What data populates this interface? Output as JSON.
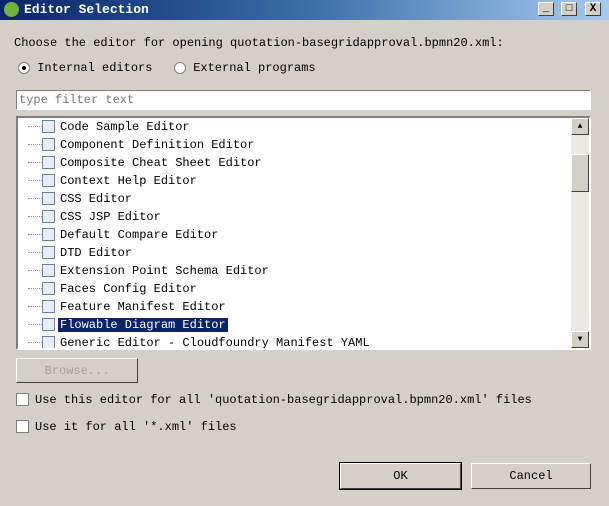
{
  "window": {
    "title": "Editor Selection",
    "minimize": "_",
    "maximize": "□",
    "close": "X"
  },
  "prompt": "Choose the editor for opening quotation-basegridapproval.bpmn20.xml:",
  "radios": {
    "internal": {
      "label": "Internal editors",
      "checked": true
    },
    "external": {
      "label": "External programs",
      "checked": false
    }
  },
  "filter": {
    "value": "",
    "placeholder": "type filter text"
  },
  "editors": [
    {
      "label": "Code Sample Editor",
      "icon": "code-sample-icon"
    },
    {
      "label": "Component Definition Editor",
      "icon": "component-icon"
    },
    {
      "label": "Composite Cheat Sheet Editor",
      "icon": "cheat-sheet-icon"
    },
    {
      "label": "Context Help Editor",
      "icon": "help-book-icon"
    },
    {
      "label": "CSS Editor",
      "icon": "css-file-icon"
    },
    {
      "label": "CSS JSP Editor",
      "icon": "css-file-icon"
    },
    {
      "label": "Default Compare Editor",
      "icon": "compare-icon"
    },
    {
      "label": "DTD Editor",
      "icon": "dtd-file-icon"
    },
    {
      "label": "Extension Point Schema Editor",
      "icon": "plugin-icon"
    },
    {
      "label": "Faces Config Editor",
      "icon": "faces-config-icon"
    },
    {
      "label": "Feature Manifest Editor",
      "icon": "feature-icon"
    },
    {
      "label": "Flowable Diagram Editor",
      "icon": "flowable-icon",
      "selected": true
    },
    {
      "label": "Generic Editor - Cloudfoundry Manifest YAML",
      "icon": "cloud-icon"
    }
  ],
  "browse_label": "Browse...",
  "checkboxes": [
    {
      "label": "Use this editor for all 'quotation-basegridapproval.bpmn20.xml' files",
      "checked": false
    },
    {
      "label": "Use it for all '*.xml' files",
      "checked": false
    }
  ],
  "ok_label": "OK",
  "cancel_label": "Cancel",
  "colors": {
    "selection": "#0a246a",
    "dialog": "#d4d0c8"
  }
}
